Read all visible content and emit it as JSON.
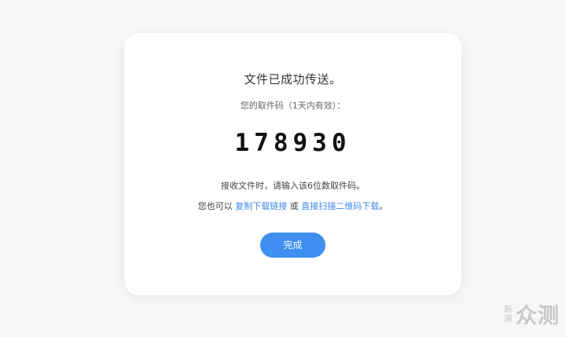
{
  "card": {
    "title": "文件已成功传送。",
    "subtitle": "您的取件码（1天内有效）：",
    "code": "178930",
    "hint": "接收文件时，请输入该6位数取件码。",
    "alt_prefix": "您也可以",
    "copy_link": "复制下载链接",
    "or_text": "或",
    "scan_link": "直接扫描二维码下载",
    "alt_suffix": "。",
    "done_button": "完成"
  },
  "watermark": {
    "small_top": "新",
    "small_bottom": "浪",
    "big": "众测"
  },
  "colors": {
    "background": "#f7f7f8",
    "card": "#ffffff",
    "primary": "#3e8ff0",
    "link": "#3f88e8"
  }
}
